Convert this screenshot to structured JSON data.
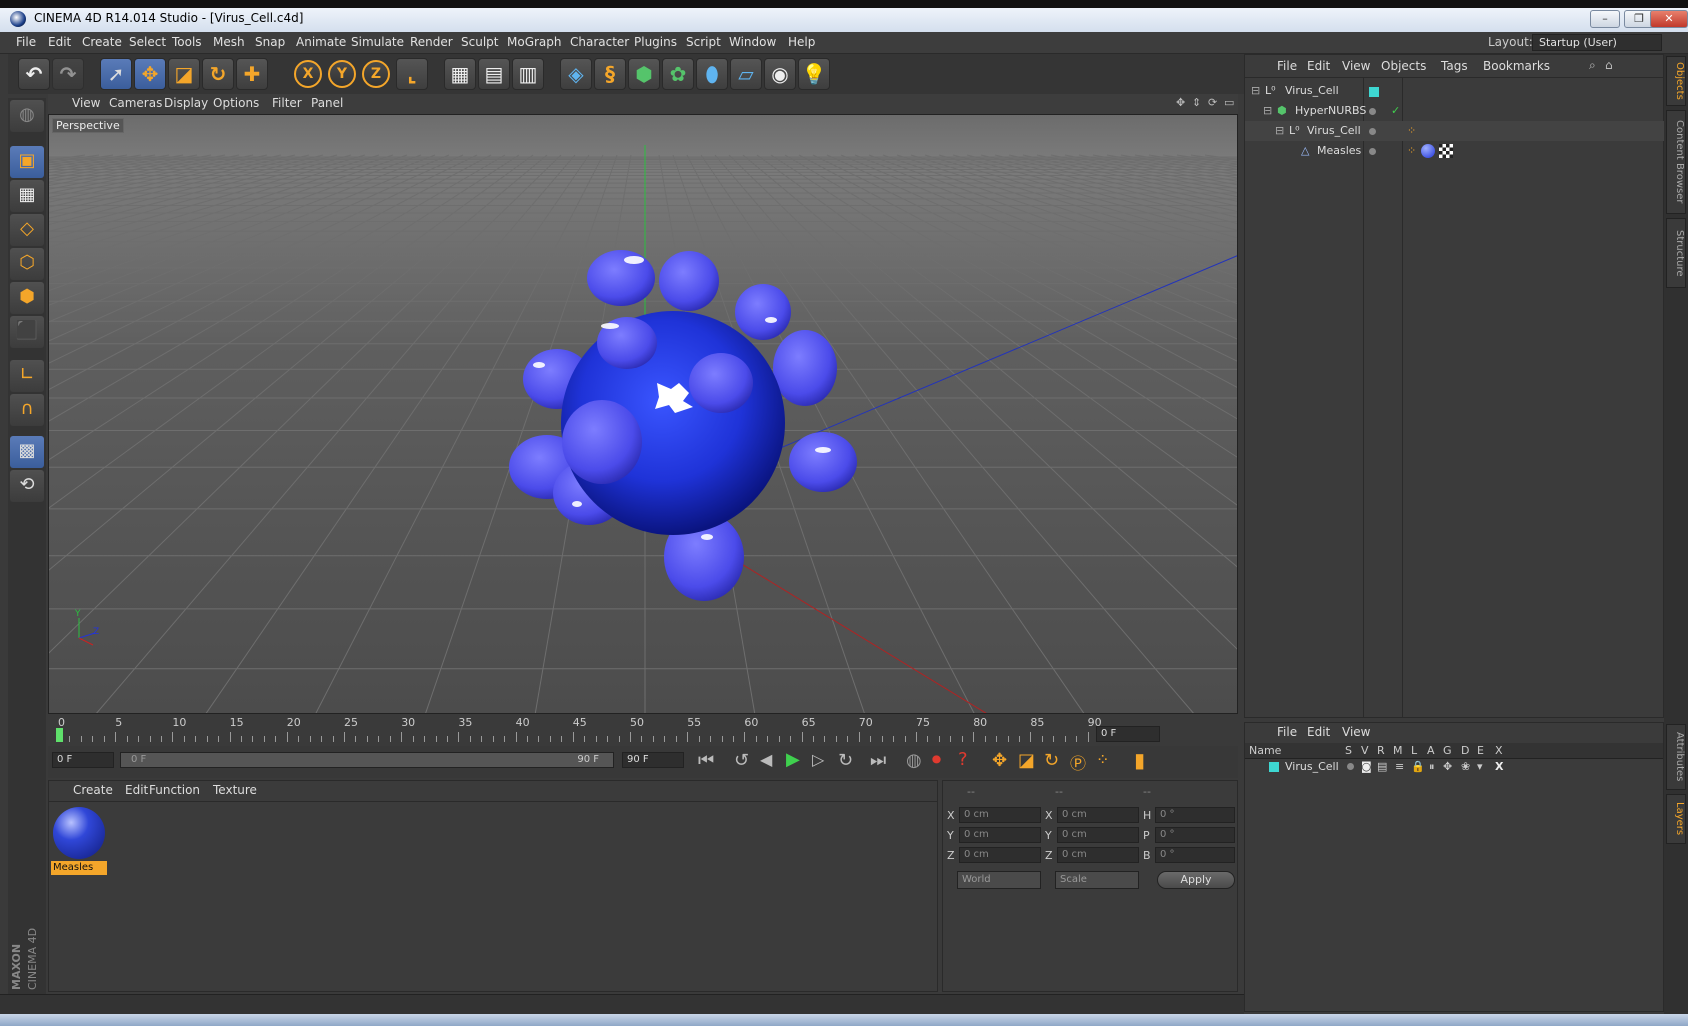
{
  "window": {
    "title": "CINEMA 4D R14.014 Studio - [Virus_Cell.c4d]"
  },
  "menu": [
    "File",
    "Edit",
    "Create",
    "Select",
    "Tools",
    "Mesh",
    "Snap",
    "Animate",
    "Simulate",
    "Render",
    "Sculpt",
    "MoGraph",
    "Character",
    "Plugins",
    "Script",
    "Window",
    "Help"
  ],
  "layout": {
    "label": "Layout:",
    "value": "Startup (User)"
  },
  "viewport": {
    "menu": [
      "View",
      "Cameras",
      "Display",
      "Options",
      "Filter",
      "Panel"
    ],
    "label": "Perspective",
    "axis_y": "Y",
    "axis_z": "Z"
  },
  "timeline": {
    "ticks": [
      "0",
      "5",
      "10",
      "15",
      "20",
      "25",
      "30",
      "35",
      "40",
      "45",
      "50",
      "55",
      "60",
      "65",
      "70",
      "75",
      "80",
      "85",
      "90"
    ],
    "current_frame": "0 F",
    "start_field": "0 F",
    "range_start": "0 F",
    "range_end": "90 F",
    "end_field": "90 F"
  },
  "materials": {
    "menu": [
      "Create",
      "Edit",
      "Function",
      "Texture"
    ],
    "items": [
      {
        "name": "Measles"
      }
    ]
  },
  "coords": {
    "headers": [
      "--",
      "--",
      "--"
    ],
    "rows": [
      {
        "a": "X",
        "av": "0 cm",
        "b": "X",
        "bv": "0 cm",
        "c": "H",
        "cv": "0 °"
      },
      {
        "a": "Y",
        "av": "0 cm",
        "b": "Y",
        "bv": "0 cm",
        "c": "P",
        "cv": "0 °"
      },
      {
        "a": "Z",
        "av": "0 cm",
        "b": "Z",
        "bv": "0 cm",
        "c": "B",
        "cv": "0 °"
      }
    ],
    "mode1": "World",
    "mode2": "Scale",
    "apply": "Apply"
  },
  "objects": {
    "menu": [
      "File",
      "Edit",
      "View",
      "Objects",
      "Tags",
      "Bookmarks"
    ],
    "tree": [
      {
        "name": "Virus_Cell",
        "indent": 0
      },
      {
        "name": "HyperNURBS",
        "indent": 1
      },
      {
        "name": "Virus_Cell",
        "indent": 2
      },
      {
        "name": "Measles",
        "indent": 3
      }
    ]
  },
  "layers": {
    "menu": [
      "File",
      "Edit",
      "View"
    ],
    "columns": [
      "Name",
      "S",
      "V",
      "R",
      "M",
      "L",
      "A",
      "G",
      "D",
      "E",
      "X"
    ],
    "rows": [
      {
        "name": "Virus_Cell"
      }
    ]
  },
  "side_tabs": [
    "Objects",
    "Content Browser",
    "Structure",
    "Attributes",
    "Layers"
  ],
  "brand": {
    "line1": "MAXON",
    "line2": "CINEMA 4D"
  },
  "colors": {
    "accent": "#f4a62a",
    "virus": "#2b3ee0",
    "selection": "#3b5e9c"
  }
}
